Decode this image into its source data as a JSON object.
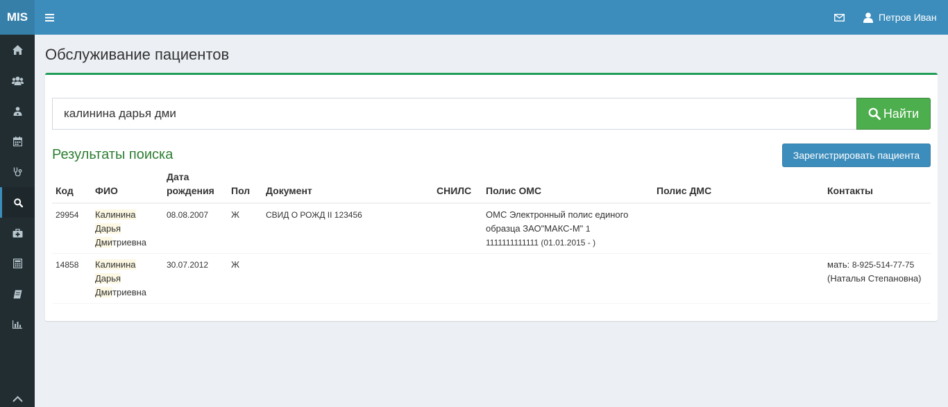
{
  "app": {
    "logo": "MIS",
    "user_name": "Петров Иван",
    "icons": {
      "menu": "hamburger-icon",
      "mail": "envelope-icon",
      "user": "user-icon"
    }
  },
  "sidebar": {
    "items": [
      {
        "icon": "home-icon"
      },
      {
        "icon": "users-icon"
      },
      {
        "icon": "doctor-icon"
      },
      {
        "icon": "calendar-icon"
      },
      {
        "icon": "stethoscope-icon"
      },
      {
        "icon": "search-icon",
        "active": true
      },
      {
        "icon": "medkit-icon"
      },
      {
        "icon": "calculator-icon"
      },
      {
        "icon": "book-icon"
      },
      {
        "icon": "bar-chart-icon"
      }
    ],
    "collapse_icon": "chevron-up-icon"
  },
  "page": {
    "title": "Обслуживание пациентов"
  },
  "search": {
    "value": "калинина дарья дми",
    "button_label": "Найти"
  },
  "results": {
    "title": "Результаты поиска",
    "register_label": "Зарегистрировать пациента",
    "columns": {
      "code": "Код",
      "fio": "ФИО",
      "dob_line1": "Дата",
      "dob_line2": "рождения",
      "sex": "Пол",
      "document": "Документ",
      "snils": "СНИЛС",
      "oms": "Полис ОМС",
      "dms": "Полис ДМС",
      "contacts": "Контакты"
    },
    "rows": [
      {
        "code": "29954",
        "last_name": "Калинина",
        "first_name": "Дарья",
        "patronymic_match": "Дми",
        "patronymic_rest": "триевна",
        "dob": "08.08.2007",
        "sex": "Ж",
        "document": "СВИД О РОЖД II 123456",
        "snils": "",
        "oms_line1": "ОМС Электронный полис единого",
        "oms_line2": "образца ЗАО\"МАКС-М\"",
        "oms_line2_num": "1",
        "oms_line3_num": "1111111111111 (01.01.2015 - )",
        "dms": "",
        "contacts_label": "",
        "contacts_phone": "",
        "contacts_rest": ""
      },
      {
        "code": "14858",
        "last_name": "Калинина",
        "first_name": "Дарья",
        "patronymic_match": "Дми",
        "patronymic_rest": "триевна",
        "dob": "30.07.2012",
        "sex": "Ж",
        "document": "",
        "snils": "",
        "oms_line1": "",
        "oms_line2": "",
        "oms_line2_num": "",
        "oms_line3_num": "",
        "dms": "",
        "contacts_label": "мать:",
        "contacts_phone": "8-925-514-77-75",
        "contacts_rest": "(Наталья Степановна)"
      }
    ]
  }
}
